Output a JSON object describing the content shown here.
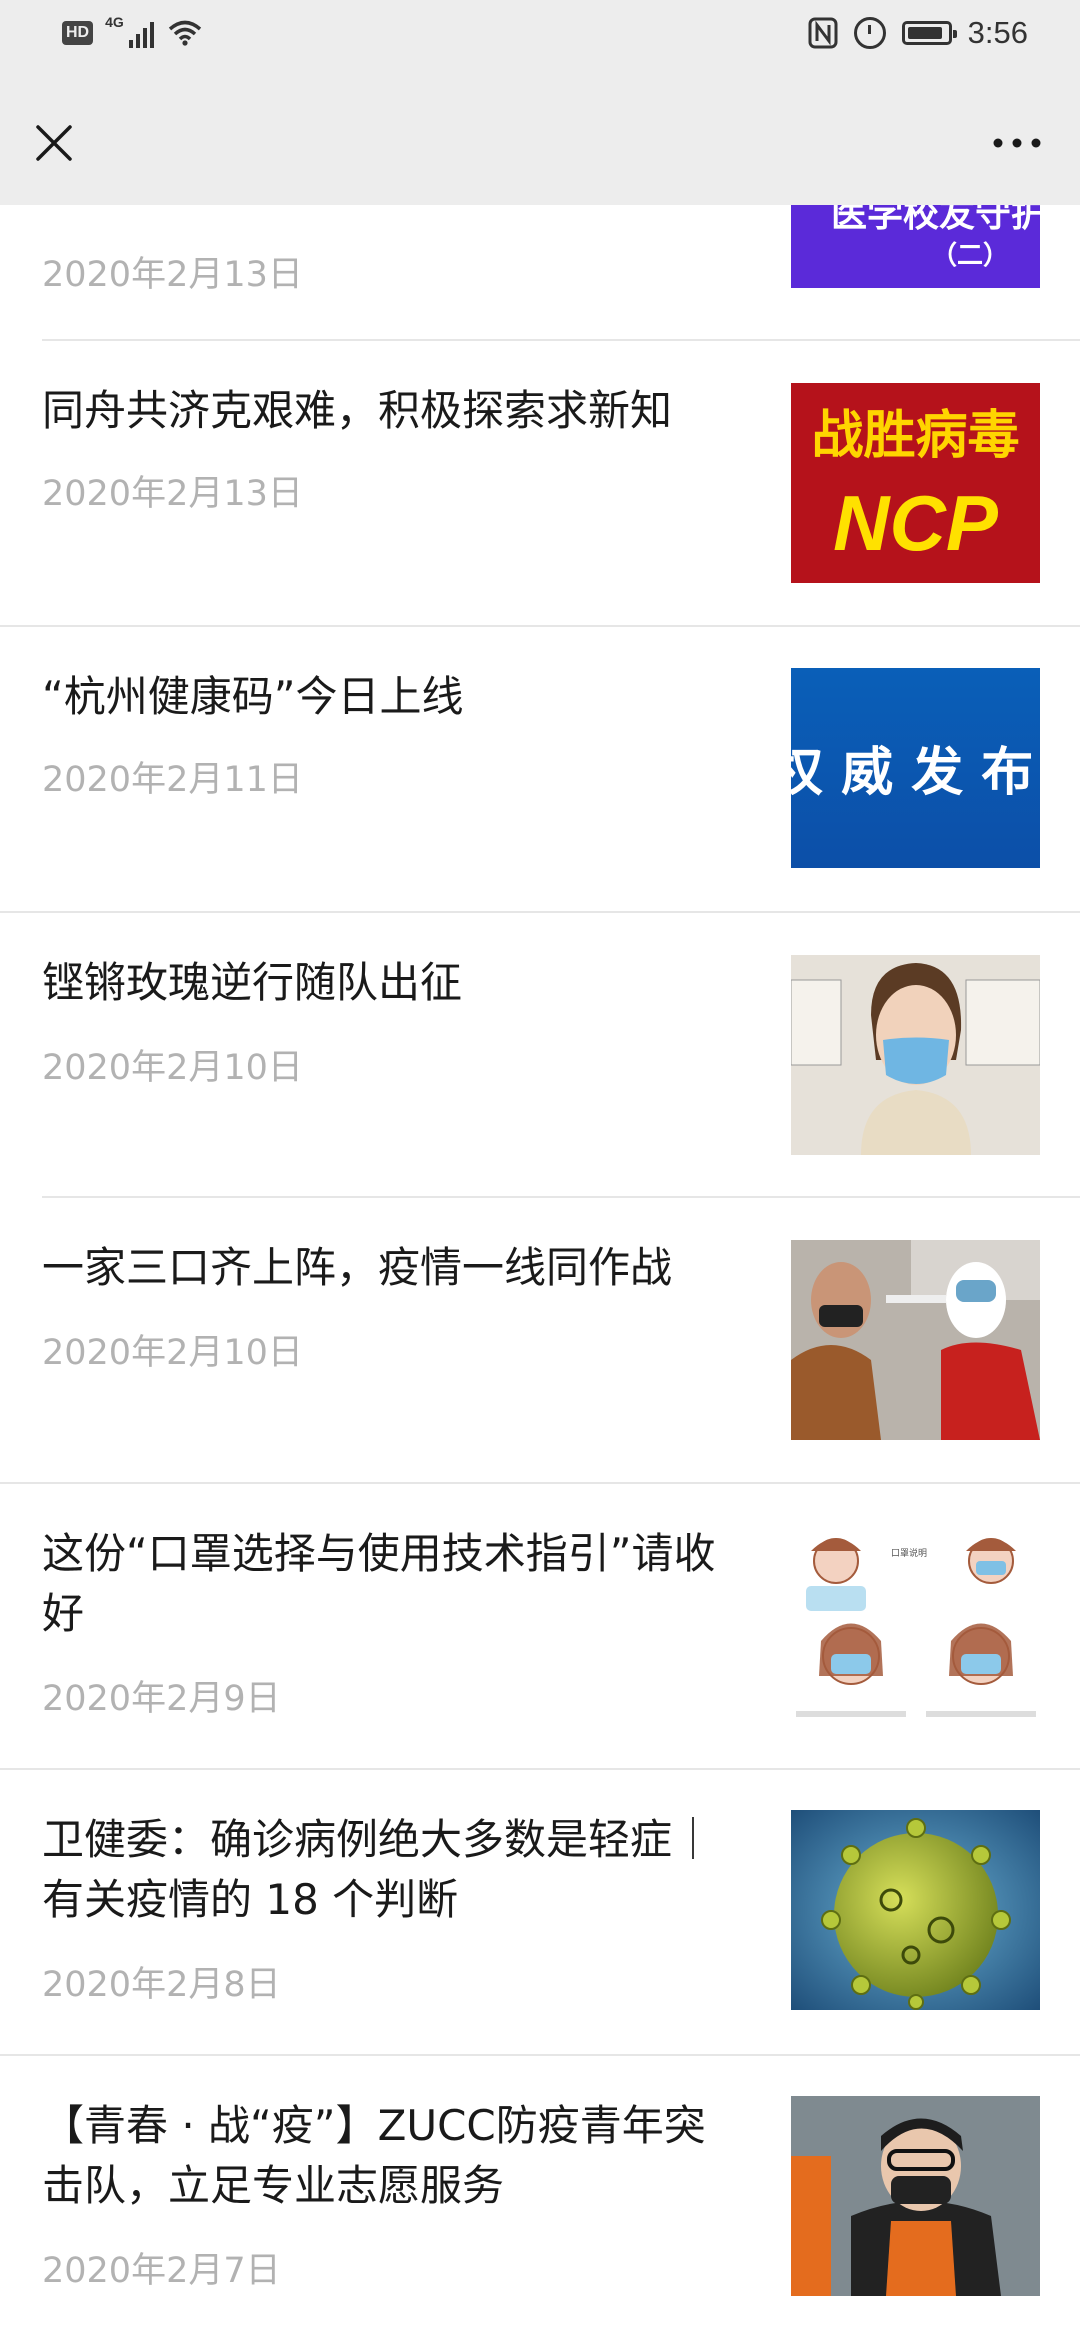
{
  "status_bar": {
    "hd": "HD",
    "network": "4G",
    "time": "3:56",
    "battery_level": 0.9
  },
  "nav": {
    "close_icon": "close-icon",
    "more_icon": "more-icon"
  },
  "articles": [
    {
      "title": "",
      "date": "2020年2月13日",
      "thumb": "医学校友守护（二）banner"
    },
    {
      "title": "同舟共济克艰难，积极探索求新知",
      "date": "2020年2月13日",
      "thumb": "战胜病毒 NCP banner"
    },
    {
      "title": "“杭州健康码”今日上线",
      "date": "2020年2月11日",
      "thumb": "权威发布 banner"
    },
    {
      "title": "铿锵玫瑰逆行随队出征",
      "date": "2020年2月10日",
      "thumb": "photo-woman-mask"
    },
    {
      "title": "一家三口齐上阵，疫情一线同作战",
      "date": "2020年2月10日",
      "thumb": "photo-temperature-check"
    },
    {
      "title": "这份“口罩选择与使用技术指引”请收好",
      "date": "2020年2月9日",
      "thumb": "mask-guide-illustration"
    },
    {
      "title": "卫健委：确诊病例绝大多数是轻症｜有关疫情的 18 个判断",
      "date": "2020年2月8日",
      "thumb": "virus-illustration"
    },
    {
      "title": "【青春 · 战“疫”】ZUCC防疫青年突击队，立足专业志愿服务",
      "date": "2020年2月7日",
      "thumb": "photo-volunteer"
    }
  ],
  "thumb_texts": {
    "t0": "医学校友守护",
    "t0b": "（二）",
    "t1": "战胜病毒",
    "t1b": "NCP",
    "t2": "权 威 发 布"
  },
  "colors": {
    "bar_bg": "#ededed",
    "date": "#b2b2b2",
    "title": "#1a1a1a",
    "divider": "#e6e6e6"
  }
}
